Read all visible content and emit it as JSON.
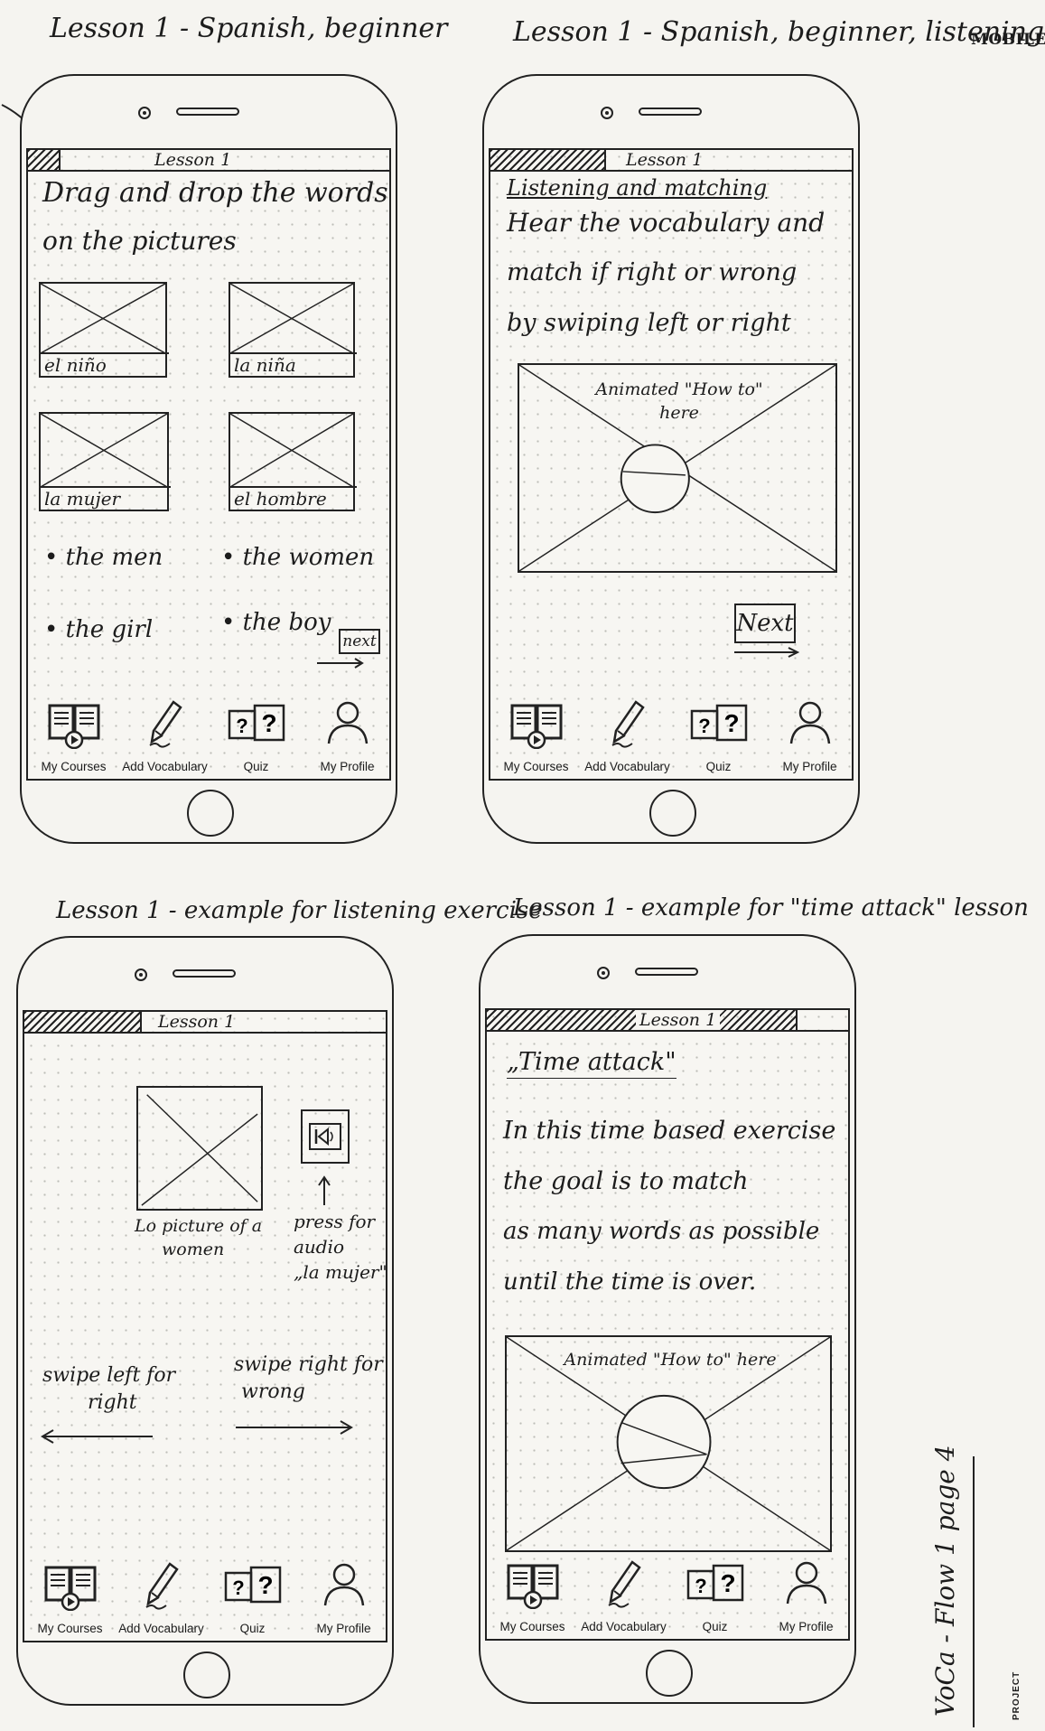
{
  "page": {
    "mobile_tag": "MOBILE",
    "side_label": "VoCa - Flow 1 page 4",
    "project_label": "PROJECT"
  },
  "tabbar": {
    "courses": "My Courses",
    "vocab": "Add Vocabulary",
    "quiz": "Quiz",
    "profile": "My Profile"
  },
  "screens": {
    "s1": {
      "caption": "Lesson 1 - Spanish, beginner",
      "title": "Lesson 1",
      "instruction_line1": "Drag and drop the words",
      "instruction_line2": "on the pictures",
      "pictures": [
        "el niño",
        "la niña",
        "la mujer",
        "el hombre"
      ],
      "words": [
        "• the men",
        "• the women",
        "• the girl",
        "• the boy"
      ],
      "next": "next"
    },
    "s2": {
      "caption": "Lesson 1 - Spanish, beginner, listening",
      "title": "Lesson 1",
      "heading": "Listening and matching",
      "body_line1": "Hear the vocabulary and",
      "body_line2": "match if right or wrong",
      "body_line3": "by swiping left or right",
      "video_line1": "Animated \"How to\"",
      "video_line2": "here",
      "next": "Next"
    },
    "s3": {
      "caption": "Lesson 1 - example for listening exercise",
      "title": "Lesson 1",
      "pic_caption_line1": "Lo picture of a",
      "pic_caption_line2": "women",
      "audio_line1": "press for",
      "audio_line2": "audio",
      "audio_line3": "„la mujer\"",
      "swipe_left_line1": "swipe left for",
      "swipe_left_line2": "right",
      "swipe_right_line1": "swipe right for",
      "swipe_right_line2": "wrong"
    },
    "s4": {
      "caption": "Lesson 1 - example for \"time attack\" lesson",
      "title": "Lesson 1",
      "heading": "„Time attack\"",
      "body_line1": "In this time based exercise",
      "body_line2": "the goal is to match",
      "body_line3": "as many words as possible",
      "body_line4": "until the time is over.",
      "video_line1": "Animated \"How to\" here"
    }
  }
}
